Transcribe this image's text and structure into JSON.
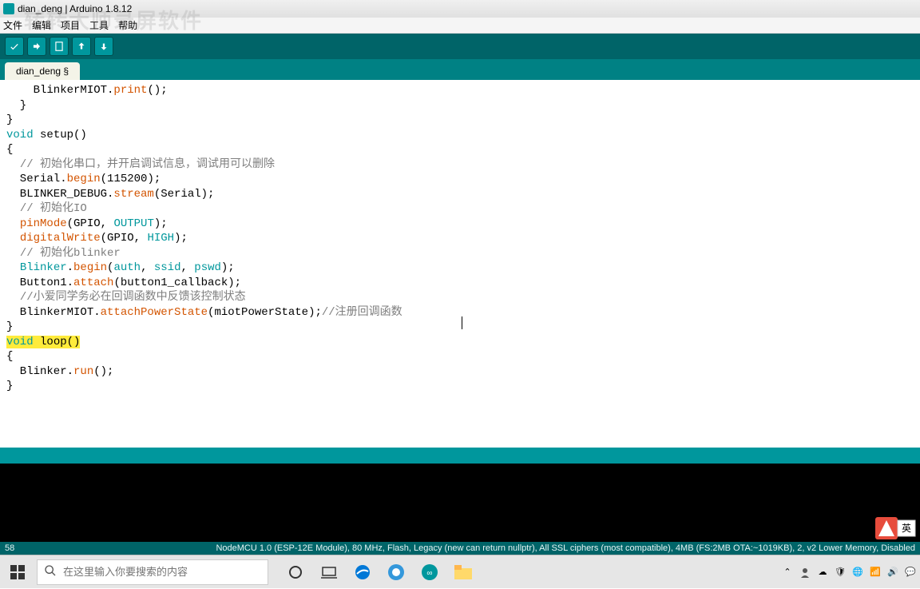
{
  "window": {
    "title": "dian_deng | Arduino 1.8.12",
    "watermark": "转转大师录屏软件"
  },
  "menu": {
    "file": "文件",
    "edit": "编辑",
    "project": "项目",
    "tools": "工具",
    "help": "帮助"
  },
  "tab": {
    "name": "dian_deng §"
  },
  "code": {
    "l1a": "    BlinkerMIOT.",
    "l1b": "print",
    "l1c": "();",
    "l2": "  }",
    "l3": "}",
    "l4": "",
    "l5a": "void",
    "l5b": " setup()",
    "l6": "{",
    "l7a": "  ",
    "l7b": "// 初始化串口，并开启调试信息，调试用可以删除",
    "l8a": "  Serial.",
    "l8b": "begin",
    "l8c": "(115200);",
    "l9a": "  BLINKER_DEBUG.",
    "l9b": "stream",
    "l9c": "(Serial);",
    "l10a": "  ",
    "l10b": "// 初始化IO",
    "l11a": "  ",
    "l11b": "pinMode",
    "l11c": "(GPIO, ",
    "l11d": "OUTPUT",
    "l11e": ");",
    "l12a": "  ",
    "l12b": "digitalWrite",
    "l12c": "(GPIO, ",
    "l12d": "HIGH",
    "l12e": ");",
    "l13": "",
    "l14a": "  ",
    "l14b": "// 初始化blinker",
    "l15a": "  ",
    "l15b": "Blinker",
    "l15c": ".",
    "l15d": "begin",
    "l15e": "(",
    "l15f": "auth",
    "l15g": ", ",
    "l15h": "ssid",
    "l15i": ", ",
    "l15j": "pswd",
    "l15k": ");",
    "l16a": "  Button1.",
    "l16b": "attach",
    "l16c": "(button1_callback);",
    "l17": "",
    "l18a": "  ",
    "l18b": "//小爱同学务必在回调函数中反馈该控制状态",
    "l19a": "  BlinkerMIOT.",
    "l19b": "attachPowerState",
    "l19c": "(miotPowerState);",
    "l19d": "//注册回调函数",
    "l20": "}",
    "l21a": "void",
    "l21b": " loop",
    "l21c": "()",
    "l22": "{",
    "l23a": "  Blinker.",
    "l23b": "run",
    "l23c": "();",
    "l24": "}"
  },
  "status": {
    "line": "58",
    "board": "NodeMCU 1.0 (ESP-12E Module), 80 MHz, Flash, Legacy (new can return nullptr), All SSL ciphers (most compatible), 4MB (FS:2MB OTA:~1019KB), 2, v2 Lower Memory, Disabled"
  },
  "taskbar": {
    "search_placeholder": "在这里输入你要搜索的内容",
    "ime": "英"
  }
}
